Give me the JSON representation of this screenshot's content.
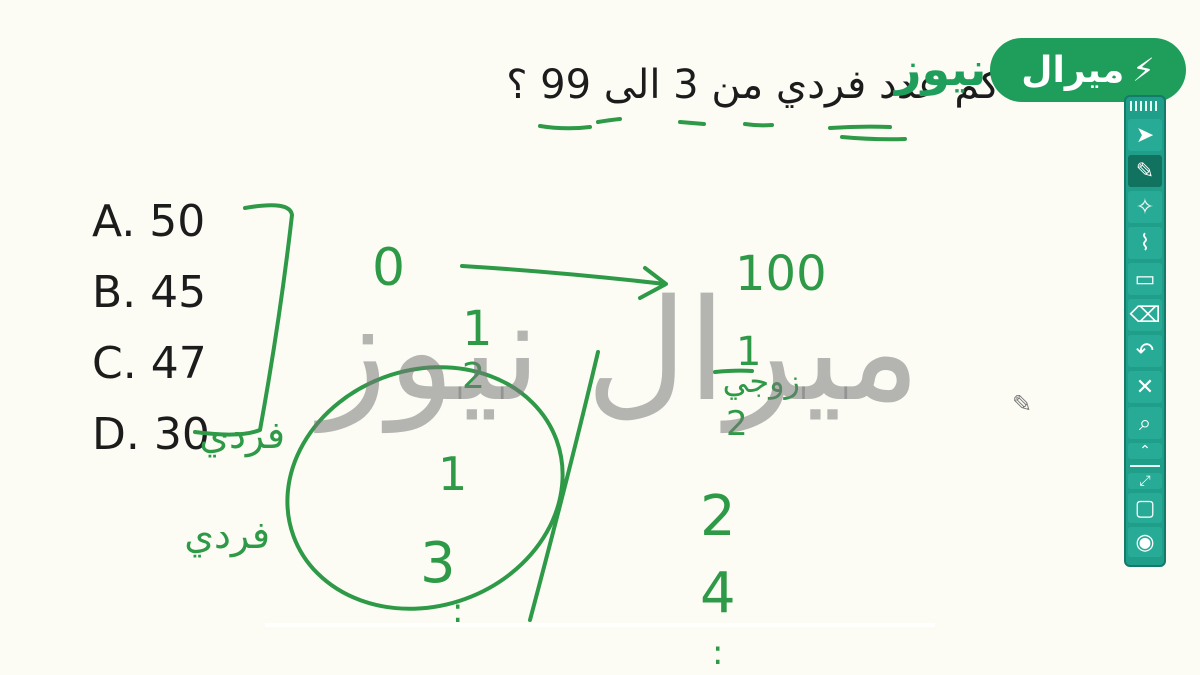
{
  "question": "كم عدد فردي من 3 الى 99 ؟",
  "options": [
    {
      "label": "A. 50"
    },
    {
      "label": "B. 45"
    },
    {
      "label": "C. 47"
    },
    {
      "label": "D. 30"
    }
  ],
  "ink": {
    "zero": "0",
    "hundred": "100",
    "one_a": "1",
    "one_b": "1",
    "one_c": "1",
    "two_a": "2",
    "two_b": "2",
    "three": "3",
    "four": "4",
    "fardi_a": "فردي",
    "fardi_b": "فردي",
    "zawji": "زوجي",
    "dots_a": ":",
    "dots_b": ":"
  },
  "watermark": "ميرال نيوز",
  "logo": {
    "main": "ميرال",
    "tail": "نيوز",
    "bolt": "⚡"
  },
  "toolbar": {
    "tools": [
      {
        "name": "select-tool",
        "glyph": "➤"
      },
      {
        "name": "pen-tool",
        "glyph": "✎"
      },
      {
        "name": "magic-pen-tool",
        "glyph": "✧"
      },
      {
        "name": "highlighter-tool",
        "glyph": "⌇"
      },
      {
        "name": "note-tool",
        "glyph": "▭"
      },
      {
        "name": "eraser-tool",
        "glyph": "⌫"
      },
      {
        "name": "undo-tool",
        "glyph": "↶"
      },
      {
        "name": "clear-tool",
        "glyph": "✕"
      },
      {
        "name": "zoom-tool",
        "glyph": "⌕"
      },
      {
        "name": "collapse-tool",
        "glyph": "⌃"
      }
    ],
    "bottom": [
      {
        "name": "resize-tool",
        "glyph": "⤢"
      },
      {
        "name": "screen-tool",
        "glyph": "▢"
      },
      {
        "name": "record-tool",
        "glyph": "◉"
      }
    ]
  },
  "colors": {
    "ink": "#2e9a47",
    "logo": "#1f9e5b",
    "toolbar": "#1f9e8a",
    "background": "#fcfcf5"
  }
}
